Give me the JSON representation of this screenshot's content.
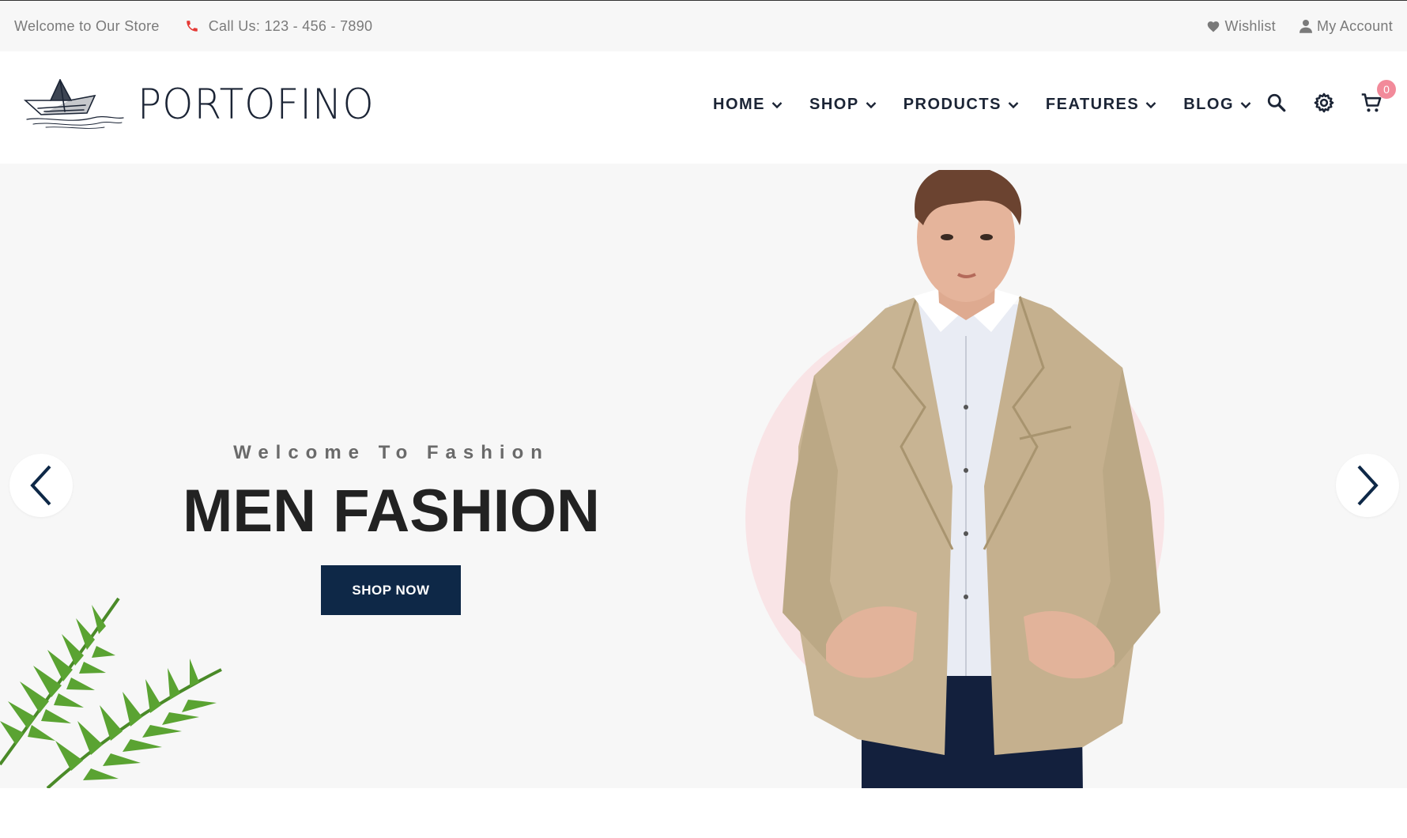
{
  "topbar": {
    "welcome": "Welcome to Our Store",
    "phone": "Call Us: 123 - 456 - 7890",
    "wishlist": "Wishlist",
    "account": "My Account"
  },
  "brand": {
    "name": "PORTOFINO"
  },
  "nav": {
    "items": [
      {
        "label": "HOME"
      },
      {
        "label": "SHOP"
      },
      {
        "label": "PRODUCTS"
      },
      {
        "label": "FEATURES"
      },
      {
        "label": "BLOG"
      }
    ]
  },
  "header_icons": {
    "search": "search-icon",
    "settings": "gear-icon",
    "cart": "cart-icon",
    "cart_count": "0"
  },
  "hero": {
    "subtitle": "Welcome To Fashion",
    "title": "MEN FASHION",
    "cta": "SHOP NOW"
  },
  "colors": {
    "primary": "#0e2847",
    "accent": "#e53935",
    "badge": "#f28a9a",
    "hero_bg": "#f7f7f7",
    "circle": "#f9e4e6"
  }
}
